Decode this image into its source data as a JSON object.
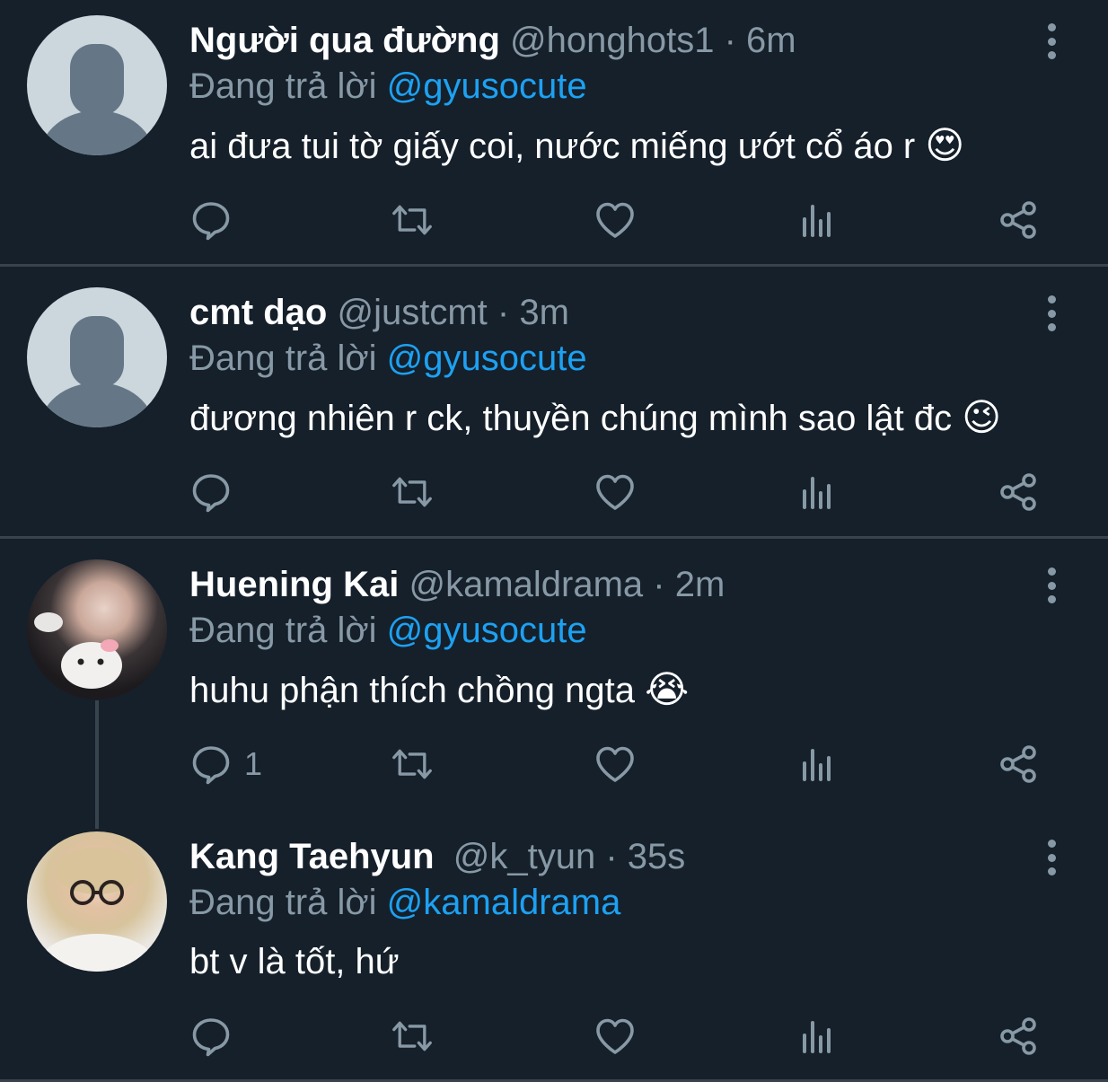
{
  "tweets": [
    {
      "name": "Người qua đường",
      "handle": "@honghots1",
      "separator": "·",
      "time": "6m",
      "reply_prefix": "Đang trả lời",
      "reply_to": "@gyusocute",
      "text": "ai đưa tui tờ giấy coi, nước miếng ướt cổ áo r",
      "emoji": "😍",
      "reply_count": ""
    },
    {
      "name": "cmt dạo",
      "handle": "@justcmt",
      "separator": "·",
      "time": "3m",
      "reply_prefix": "Đang trả lời",
      "reply_to": "@gyusocute",
      "text": "đương nhiên r ck, thuyền chúng mình sao lật đc",
      "emoji": "😉",
      "reply_count": ""
    },
    {
      "name": "Huening Kai",
      "handle": "@kamaldrama",
      "separator": "·",
      "time": "2m",
      "reply_prefix": "Đang trả lời",
      "reply_to": "@gyusocute",
      "text": "huhu phận thích chồng ngta",
      "emoji": "😭",
      "reply_count": "1"
    },
    {
      "name": "Kang Taehyun",
      "handle": "@k_tyun",
      "separator": "·",
      "time": "35s",
      "reply_prefix": "Đang trả lời",
      "reply_to": "@kamaldrama",
      "text": "bt v là tốt, hứ",
      "emoji": "",
      "reply_count": ""
    }
  ],
  "colors": {
    "background": "#15202b",
    "muted": "#8899a6",
    "mention": "#1da1f2",
    "divider": "#38444d"
  }
}
